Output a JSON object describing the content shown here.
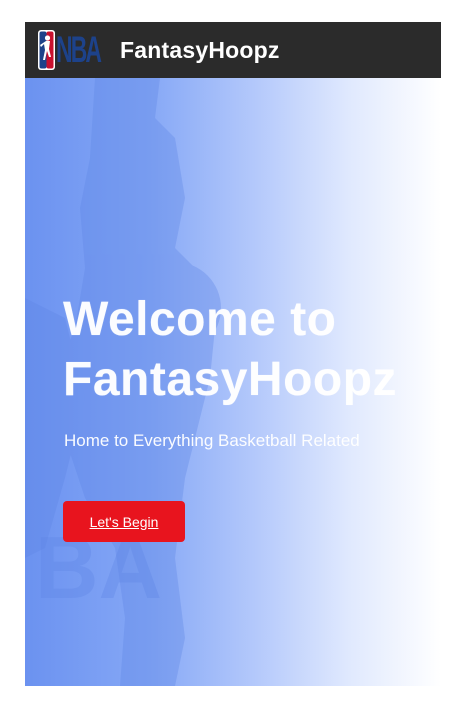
{
  "navbar": {
    "logo_text": "NBA",
    "brand": "FantasyHoopz"
  },
  "hero": {
    "title_line1": "Welcome to",
    "title_line2": "FantasyHoopz",
    "subtitle": "Home to Everything Basketball Related",
    "cta_label": "Let's Begin",
    "watermark_text": "BA"
  },
  "colors": {
    "navbar_bg": "#2b2b2b",
    "logo_blue": "#1d428a",
    "logo_red": "#c8102e",
    "gradient_start": "#6b92f0",
    "gradient_end": "#ffffff",
    "cta_bg": "#e8141e"
  },
  "icons": {
    "logo": "nba-logo-icon"
  }
}
